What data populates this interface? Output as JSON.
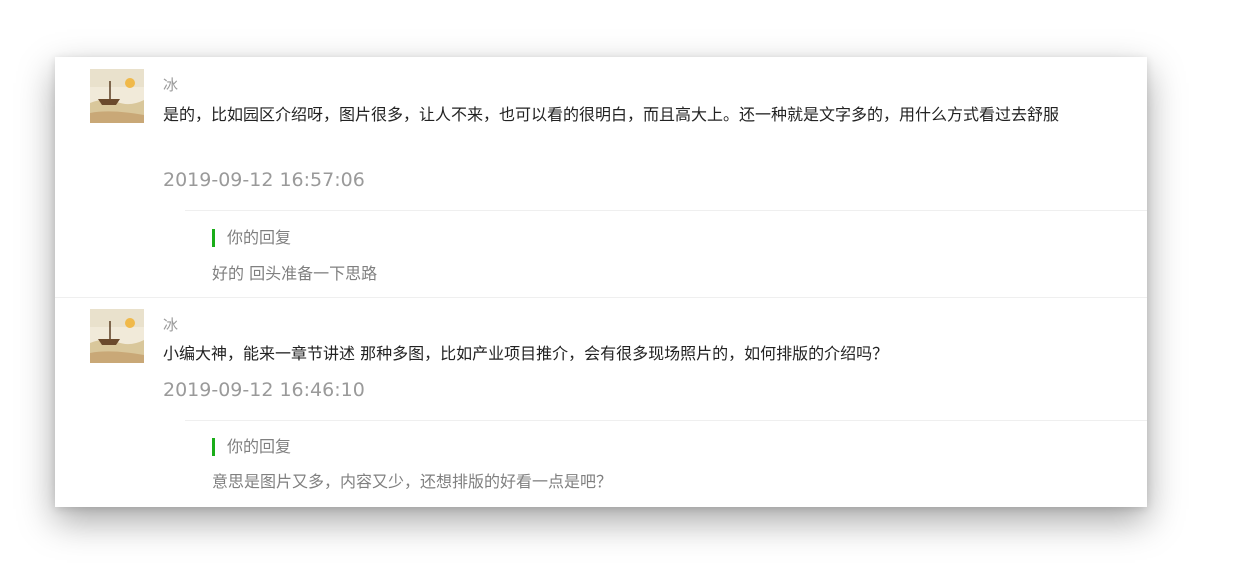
{
  "comments": [
    {
      "user": "冰",
      "text": "是的，比如园区介绍呀，图片很多，让人不来，也可以看的很明白，而且高大上。还一种就是文字多的，用什么方式看过去舒服",
      "time": "2019-09-12 16:57:06",
      "reply_label": "你的回复",
      "reply_text": "好的 回头准备一下思路"
    },
    {
      "user": "冰",
      "text": "小编大神，能来一章节讲述 那种多图，比如产业项目推介，会有很多现场照片的，如何排版的介绍吗？",
      "time": "2019-09-12 16:46:10",
      "reply_label": "你的回复",
      "reply_text": "意思是图片又多，内容又少，还想排版的好看一点是吧？"
    }
  ],
  "colors": {
    "accent": "#1aad19",
    "meta_text": "#9a9a9a",
    "body_text": "#222222"
  }
}
